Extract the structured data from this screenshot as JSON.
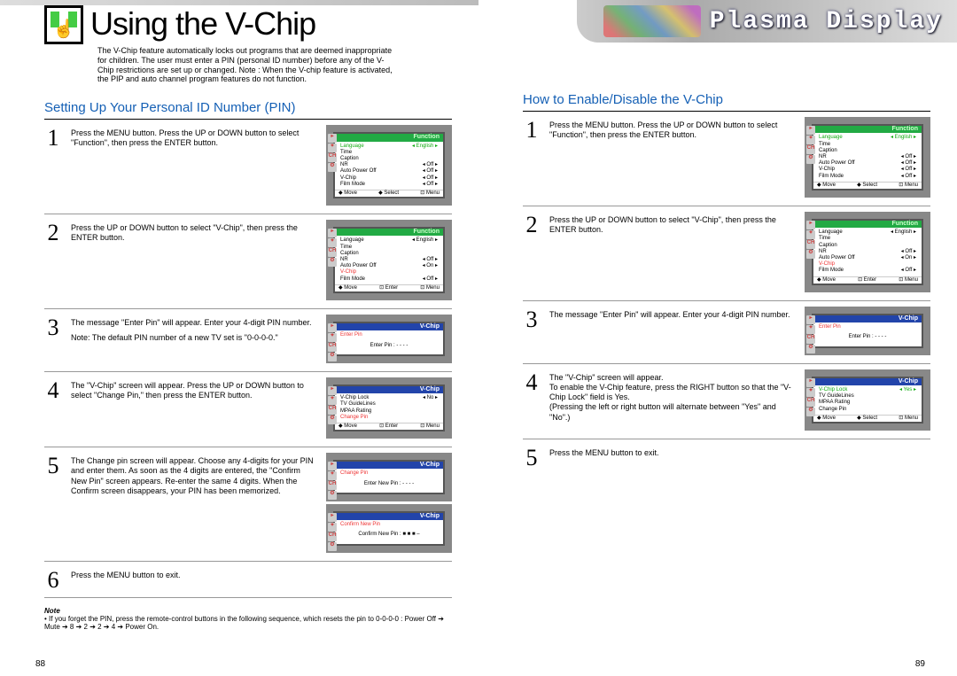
{
  "banner": "Plasma Display",
  "page_left_num": "88",
  "page_right_num": "89",
  "left": {
    "title": "Using the V-Chip",
    "intro": "The V-Chip feature automatically locks out programs that are deemed inappropriate for children. The user must enter a PIN (personal ID number) before any of the V-Chip restrictions are set up or changed.\nNote : When the V-chip feature is activated, the PIP and auto channel program features do not function.",
    "section": "Setting Up Your Personal ID Number (PIN)",
    "steps": [
      {
        "n": "1",
        "text": "Press the MENU button. Press the UP or DOWN button to select \"Function\", then press the ENTER button."
      },
      {
        "n": "2",
        "text": "Press the UP or DOWN button to select \"V-Chip\", then press the ENTER button."
      },
      {
        "n": "3",
        "text": "The message \"Enter Pin\" will appear. Enter your 4-digit PIN number.",
        "sub": "Note: The default PIN number of a new TV set is \"0-0-0-0.\""
      },
      {
        "n": "4",
        "text": "The \"V-Chip\" screen will appear. Press the UP or DOWN button to select \"Change Pin,\" then press the ENTER button."
      },
      {
        "n": "5",
        "text": "The Change pin screen will appear. Choose any 4-digits for your PIN and enter them.\nAs soon as the 4 digits are entered, the \"Confirm New Pin\" screen appears. Re-enter the same 4 digits. When the Confirm screen disappears, your PIN has been memorized."
      },
      {
        "n": "6",
        "text": "Press the MENU button to exit."
      }
    ],
    "note_hd": "Note",
    "note": "If you forget the PIN, press the remote-control buttons in the following sequence, which resets the pin to 0-0-0-0 : Power Off ➔ Mute ➔ 8 ➔ 2 ➔ 2 ➔ 4 ➔ Power On."
  },
  "right": {
    "section": "How to Enable/Disable the V-Chip",
    "steps": [
      {
        "n": "1",
        "text": "Press the MENU button. Press the UP or DOWN button to select \"Function\", then press the ENTER button."
      },
      {
        "n": "2",
        "text": "Press the UP or DOWN button to select \"V-Chip\", then press the ENTER button."
      },
      {
        "n": "3",
        "text": "The message \"Enter Pin\" will appear. Enter your 4-digit PIN number."
      },
      {
        "n": "4",
        "text": "The \"V-Chip\" screen will appear.\nTo enable the V-Chip feature, press the RIGHT button so that the \"V-Chip Lock\" field is Yes.\n(Pressing the left or right button will alternate between \"Yes\" and \"No\".)"
      },
      {
        "n": "5",
        "text": "Press the MENU button to exit."
      }
    ]
  },
  "osd": {
    "function": "Function",
    "vchip": "V-Chip",
    "rows_fn": [
      [
        "Language",
        "English"
      ],
      [
        "Time",
        ""
      ],
      [
        "Caption",
        ""
      ],
      [
        "NR",
        "Off"
      ],
      [
        "Auto Power Off",
        "Off"
      ],
      [
        "V-Chip",
        "Off"
      ],
      [
        "Film Mode",
        "Off"
      ]
    ],
    "rows_fn2": [
      [
        "Language",
        "English"
      ],
      [
        "Time",
        ""
      ],
      [
        "Caption",
        ""
      ],
      [
        "NR",
        "Off"
      ],
      [
        "Auto Power Off",
        "On"
      ],
      [
        "V-Chip",
        ""
      ],
      [
        "Film Mode",
        "Off"
      ]
    ],
    "rows_vchip": [
      [
        "V-Chip Lock",
        "No"
      ],
      [
        "TV GuideLines",
        ""
      ],
      [
        "MPAA Rating",
        ""
      ],
      [
        "Change Pin",
        ""
      ]
    ],
    "rows_vchip_yes": [
      [
        "V-Chip Lock",
        "Yes"
      ],
      [
        "TV GuideLines",
        ""
      ],
      [
        "MPAA Rating",
        ""
      ],
      [
        "Change Pin",
        ""
      ]
    ],
    "enter_pin": "Enter Pin",
    "enter_pin_val": "Enter Pin    :    - - - -",
    "change_pin": "Change Pin",
    "enter_new_pin": "Enter New Pin  :   - - - -",
    "confirm_pin": "Confirm New Pin",
    "confirm_pin_val": "Confirm New Pin  :  ■ ■ ■ –",
    "ft_move": "◆ Move",
    "ft_select": "◆ Select",
    "ft_enter": "⊡ Enter",
    "ft_menu": "⊡ Menu"
  }
}
